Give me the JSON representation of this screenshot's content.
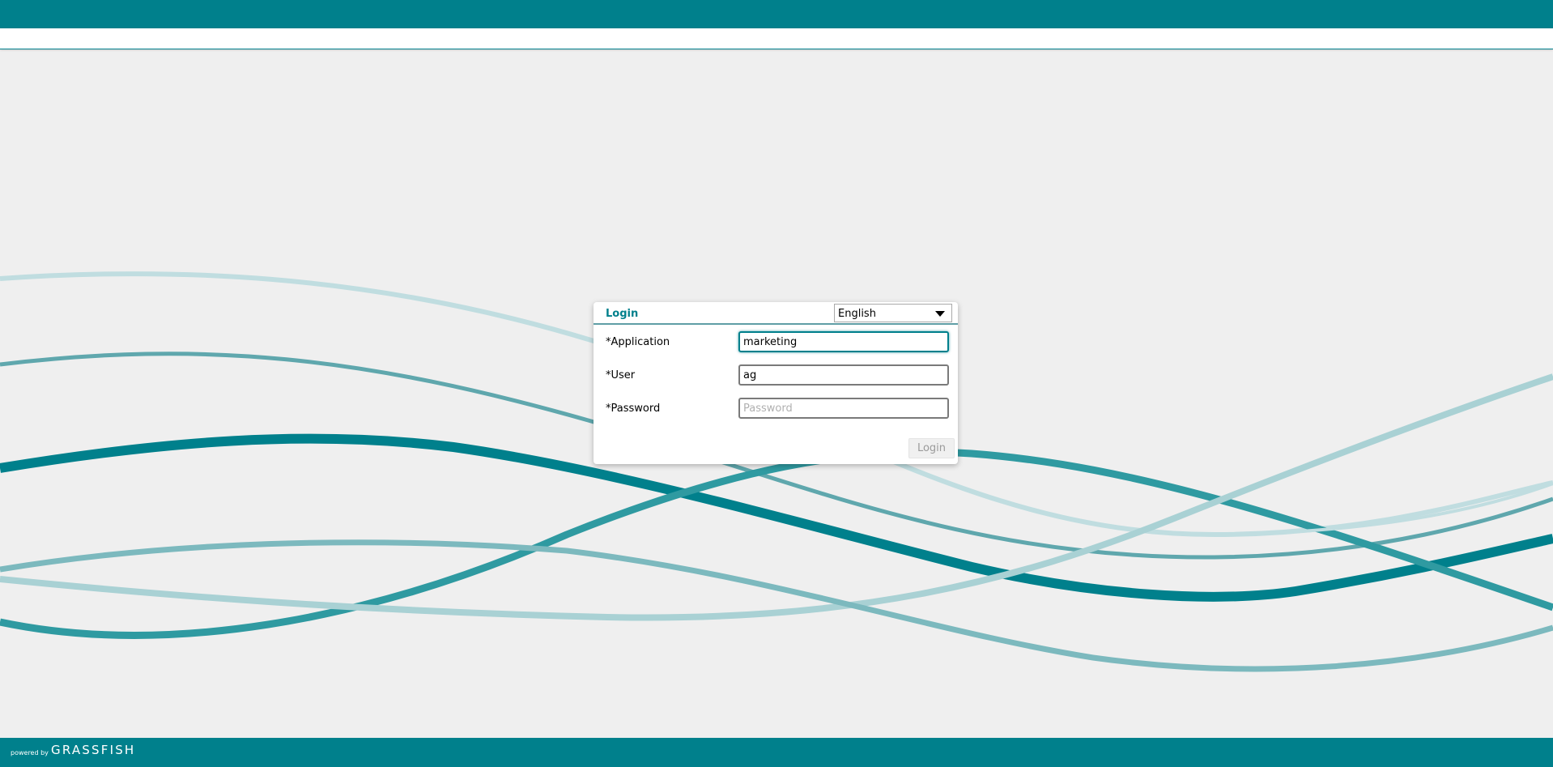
{
  "dialog": {
    "title": "Login",
    "language": {
      "selected": "English"
    },
    "fields": {
      "application": {
        "label": "*Application",
        "value": "marketing"
      },
      "user": {
        "label": "*User",
        "value": "ag"
      },
      "password": {
        "label": "*Password",
        "placeholder": "Password"
      }
    },
    "login_label": "Login"
  },
  "footer": {
    "powered_by": "powered by",
    "brand": "GRASSFISH"
  },
  "colors": {
    "accent": "#00808c",
    "background": "#efefef"
  },
  "icons": {
    "language_select": "chevron-down-icon"
  }
}
